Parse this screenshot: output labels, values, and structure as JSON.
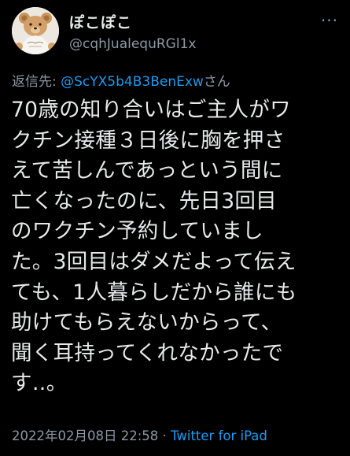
{
  "author": {
    "display_name": "ぽこぽこ",
    "handle": "@cqhJualequRGl1x",
    "avatar_icon": "teddy-bear-avatar"
  },
  "more_icon": "more-options-icon",
  "reply": {
    "prefix": "返信先: ",
    "mention": "@ScYX5b4B3BenExw",
    "suffix": "さん"
  },
  "tweet": {
    "lines": [
      "70歳の知り合いはご主人がワ",
      "クチン接種３日後に胸を押さ",
      "えて苦しんであっという間に",
      "亡くなったのに、先日3回目",
      "のワクチン予約していまし",
      "た。3回目はダメだよって伝え",
      "ても、1人暮らしだから誰にも",
      "助けてもらえないからって、",
      "聞く耳持ってくれなかったで",
      "す‥。"
    ]
  },
  "meta": {
    "timestamp": "2022年02月08日 22:58",
    "separator": " · ",
    "source": "Twitter for iPad"
  },
  "colors": {
    "background": "#000000",
    "text": "#e7e9ea",
    "secondary": "#8b98a5",
    "link": "#1d9bf0"
  }
}
